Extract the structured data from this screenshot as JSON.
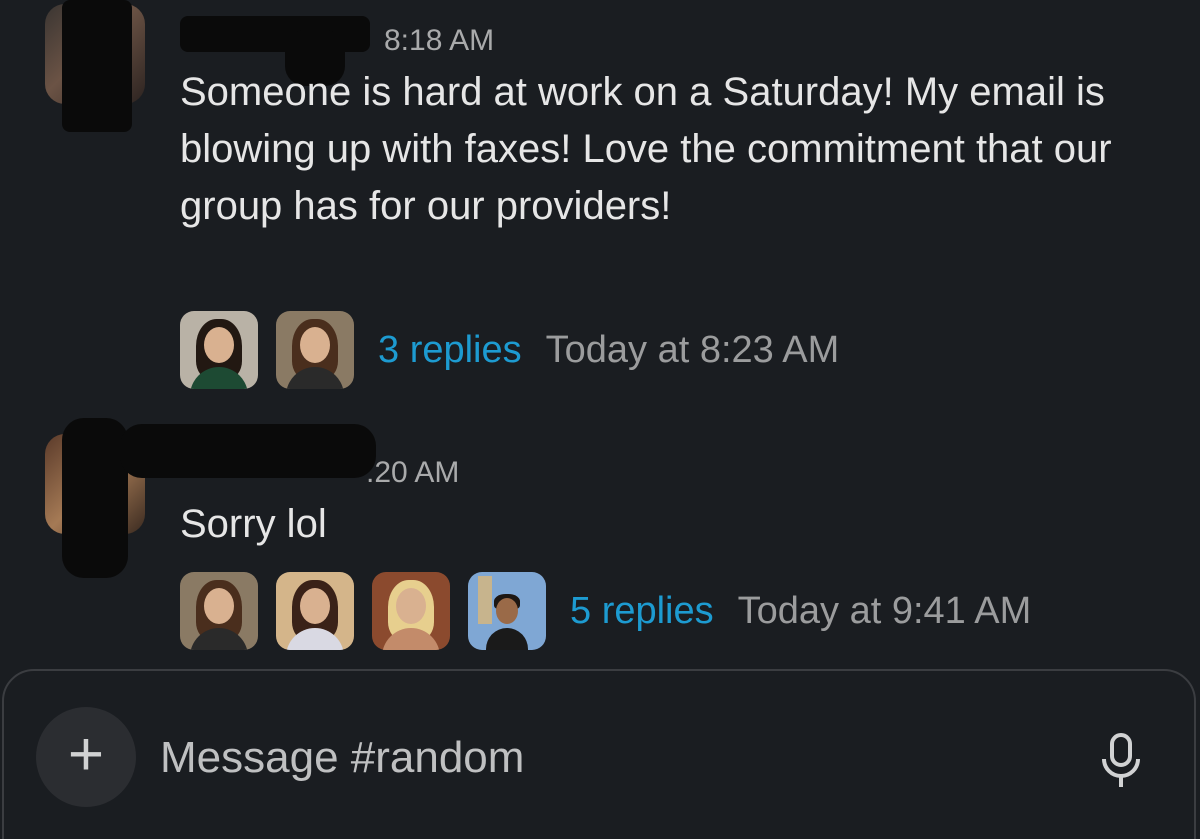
{
  "messages": [
    {
      "sender": "",
      "time": "8:18 AM",
      "text": "Someone is hard at work on a Saturday! My email is blowing up with faxes! Love the commitment that our group has for our providers!",
      "thread": {
        "replies": "3 replies",
        "last_reply": "Today at 8:23 AM",
        "participant_avatars": [
          "woman-dark-hair-green-blazer",
          "woman-dark-hair-smiling"
        ]
      }
    },
    {
      "sender": "",
      "time": ".20 AM",
      "text": "Sorry lol",
      "thread": {
        "replies": "5 replies",
        "last_reply": "Today at 9:41 AM",
        "participant_avatars": [
          "woman-dark-hair-smiling",
          "woman-brown-hair",
          "woman-blonde-hair",
          "man-tower-background"
        ]
      }
    }
  ],
  "composer": {
    "placeholder": "Message #random",
    "add_icon": "plus-icon",
    "mic_icon": "microphone-icon"
  },
  "colors": {
    "background": "#1a1d21",
    "link": "#1d9bd1",
    "muted": "#9b9c9d"
  }
}
